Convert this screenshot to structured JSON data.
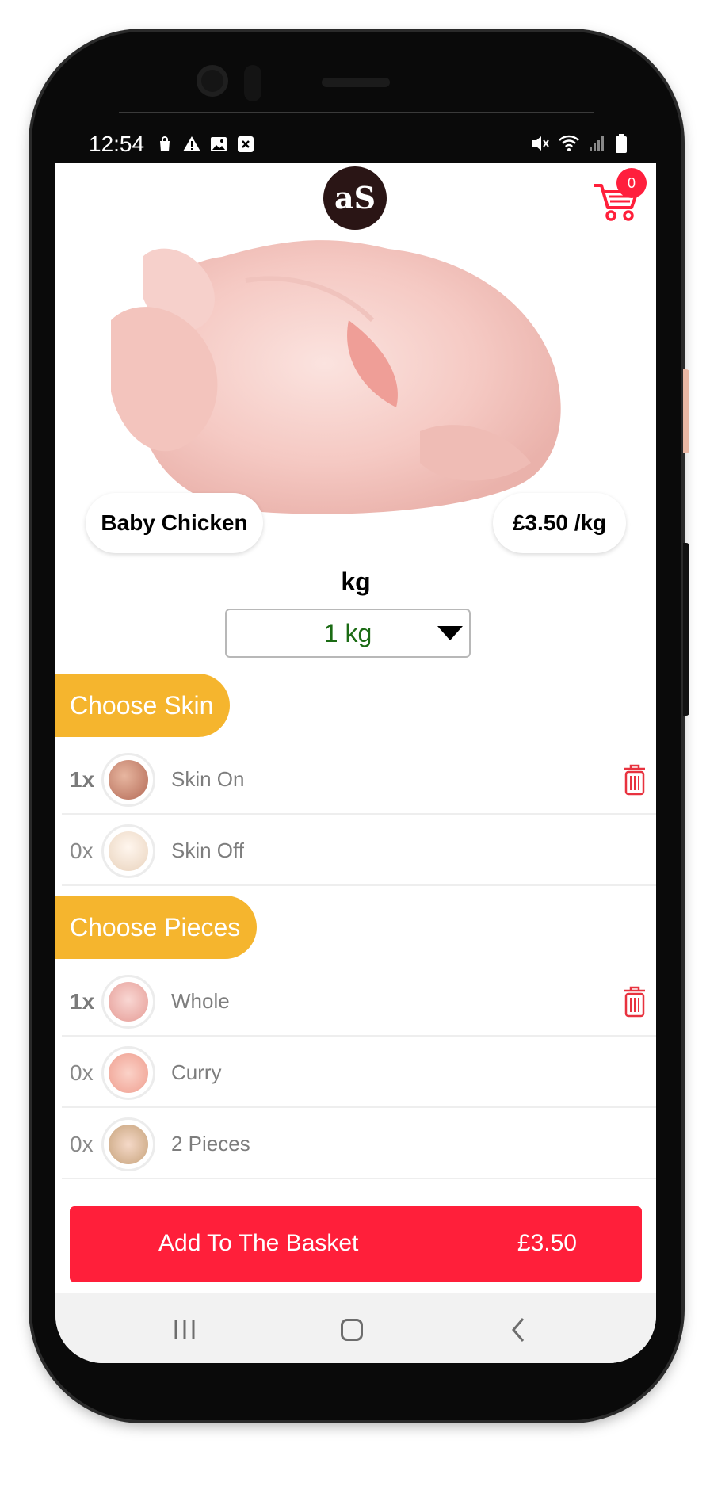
{
  "status_bar": {
    "time": "12:54",
    "left_icons": [
      "shopping-bag-icon",
      "warning-icon",
      "image-icon",
      "close-box-icon"
    ],
    "right_icons": [
      "mute-icon",
      "wifi-icon",
      "signal-icon",
      "battery-icon"
    ]
  },
  "header": {
    "logo_text": "aS",
    "cart_count": "0"
  },
  "product": {
    "name": "Baby Chicken",
    "price": "£3.50 /kg"
  },
  "weight": {
    "label": "kg",
    "selected": "1 kg"
  },
  "sections": [
    {
      "title": "Choose Skin",
      "items": [
        {
          "qty": "1x",
          "label": "Skin On",
          "selected": true
        },
        {
          "qty": "0x",
          "label": "Skin Off",
          "selected": false
        }
      ]
    },
    {
      "title": "Choose Pieces",
      "items": [
        {
          "qty": "1x",
          "label": "Whole",
          "selected": true
        },
        {
          "qty": "0x",
          "label": "Curry",
          "selected": false
        },
        {
          "qty": "0x",
          "label": "2 Pieces",
          "selected": false
        }
      ]
    }
  ],
  "basket": {
    "label": "Add To The Basket",
    "total": "£3.50"
  },
  "colors": {
    "accent_red": "#ff1f3a",
    "section_yellow": "#f5b52e",
    "selected_green": "#1b6b14"
  }
}
